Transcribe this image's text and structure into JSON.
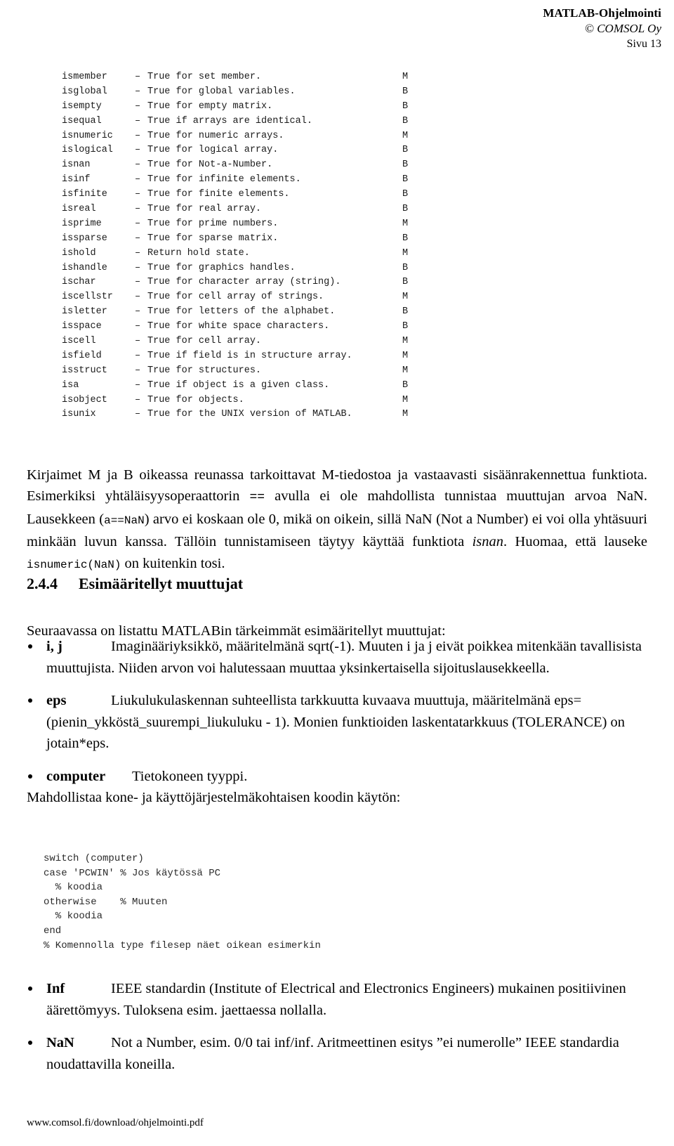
{
  "header": {
    "title": "MATLAB-Ohjelmointi",
    "copyright": "© COMSOL Oy",
    "page_label": "Sivu 13"
  },
  "function_listing": {
    "dash": "–",
    "rows": [
      {
        "name": "ismember",
        "desc": "True for set member.",
        "flag": "M"
      },
      {
        "name": "isglobal",
        "desc": "True for global variables.",
        "flag": "B"
      },
      {
        "name": "isempty",
        "desc": "True for empty matrix.",
        "flag": "B"
      },
      {
        "name": "isequal",
        "desc": "True if arrays are identical.",
        "flag": "B"
      },
      {
        "name": "isnumeric",
        "desc": "True for numeric arrays.",
        "flag": "M"
      },
      {
        "name": "islogical",
        "desc": "True for logical array.",
        "flag": "B"
      },
      {
        "name": "isnan",
        "desc": "True for Not-a-Number.",
        "flag": "B"
      },
      {
        "name": "isinf",
        "desc": "True for infinite elements.",
        "flag": "B"
      },
      {
        "name": "isfinite",
        "desc": "True for finite elements.",
        "flag": "B"
      },
      {
        "name": "isreal",
        "desc": "True for real array.",
        "flag": "B"
      },
      {
        "name": "isprime",
        "desc": "True for prime numbers.",
        "flag": "M"
      },
      {
        "name": "issparse",
        "desc": "True for sparse matrix.",
        "flag": "B"
      },
      {
        "name": "ishold",
        "desc": "Return hold state.",
        "flag": "M"
      },
      {
        "name": "ishandle",
        "desc": "True for graphics handles.",
        "flag": "B"
      },
      {
        "name": "ischar",
        "desc": "True for character array (string).",
        "flag": "B"
      },
      {
        "name": "iscellstr",
        "desc": "True for cell array of strings.",
        "flag": "M"
      },
      {
        "name": "isletter",
        "desc": "True for letters of the alphabet.",
        "flag": "B"
      },
      {
        "name": "isspace",
        "desc": "True for white space characters.",
        "flag": "B"
      },
      {
        "name": "iscell",
        "desc": "True for cell array.",
        "flag": "M"
      },
      {
        "name": "isfield",
        "desc": "True if field is in structure array.",
        "flag": "M"
      },
      {
        "name": "isstruct",
        "desc": "True for structures.",
        "flag": "M"
      },
      {
        "name": "isa",
        "desc": "True if object is a given class.",
        "flag": "B"
      },
      {
        "name": "isobject",
        "desc": "True for objects.",
        "flag": "M"
      },
      {
        "name": "isunix",
        "desc": "True for the UNIX version of MATLAB.",
        "flag": "M"
      }
    ]
  },
  "paragraph_main": {
    "t1": "Kirjaimet M ja B oikeassa reunassa tarkoittavat M-tiedostoa ja vastaavasti sisäänrakennettua funktiota. Esimerkiksi yhtäläisyysoperaattorin ",
    "op": "==",
    "t2": " avulla ei ole mahdollista tunnistaa muuttujan arvoa NaN. Lausekkeen (",
    "code1": "a==NaN",
    "t3": ") arvo ei koskaan ole 0, mikä on oikein, sillä NaN (Not a Number) ei voi olla yhtäsuuri minkään luvun kanssa. Tällöin tunnistamiseen täytyy käyttää funktiota ",
    "it1": "isnan",
    "t4": ". Huomaa, että lauseke ",
    "code2": "isnumeric(NaN)",
    "t5": " on kuitenkin tosi."
  },
  "section": {
    "number": "2.4.4",
    "title": "Esimääritellyt muuttujat",
    "intro": "Seuraavassa on listattu MATLABin tärkeimmät esimääritellyt muuttujat:"
  },
  "variables": [
    {
      "term": "i, j",
      "text": "Imaginääriyksikkö, määritelmänä sqrt(-1). Muuten i ja j eivät poikkea mitenkään tavallisista muuttujista. Niiden arvon voi halutessaan muuttaa yksinkertaisella sijoituslausekkeella."
    },
    {
      "term": "eps",
      "text": "Liukulukulaskennan suhteellista tarkkuutta kuvaava muuttuja, määritelmänä eps=(pienin_ykköstä_suurempi_liukuluku - 1). Monien funktioiden laskentatarkkuus (TOLERANCE) on jotain*eps."
    },
    {
      "term": "computer",
      "text": "Tietokoneen tyyppi.",
      "text2": "Mahdollistaa kone- ja käyttöjärjestelmäkohtaisen koodin käytön:"
    }
  ],
  "code_block": "switch (computer)\ncase 'PCWIN' % Jos käytössä PC\n  % koodia\notherwise    % Muuten\n  % koodia\nend\n% Komennolla type filesep näet oikean esimerkin",
  "variables_bottom": [
    {
      "term": "Inf",
      "text": "IEEE standardin (Institute of Electrical and Electronics Engineers) mukainen positiivinen äärettömyys. Tuloksena esim. jaettaessa nollalla."
    },
    {
      "term": "NaN",
      "text": "Not a Number, esim. 0/0  tai  inf/inf. Aritmeettinen esitys ”ei numerolle” IEEE standardia noudattavilla koneilla."
    }
  ],
  "footer": {
    "url": "www.comsol.fi/download/ohjelmointi.pdf"
  }
}
